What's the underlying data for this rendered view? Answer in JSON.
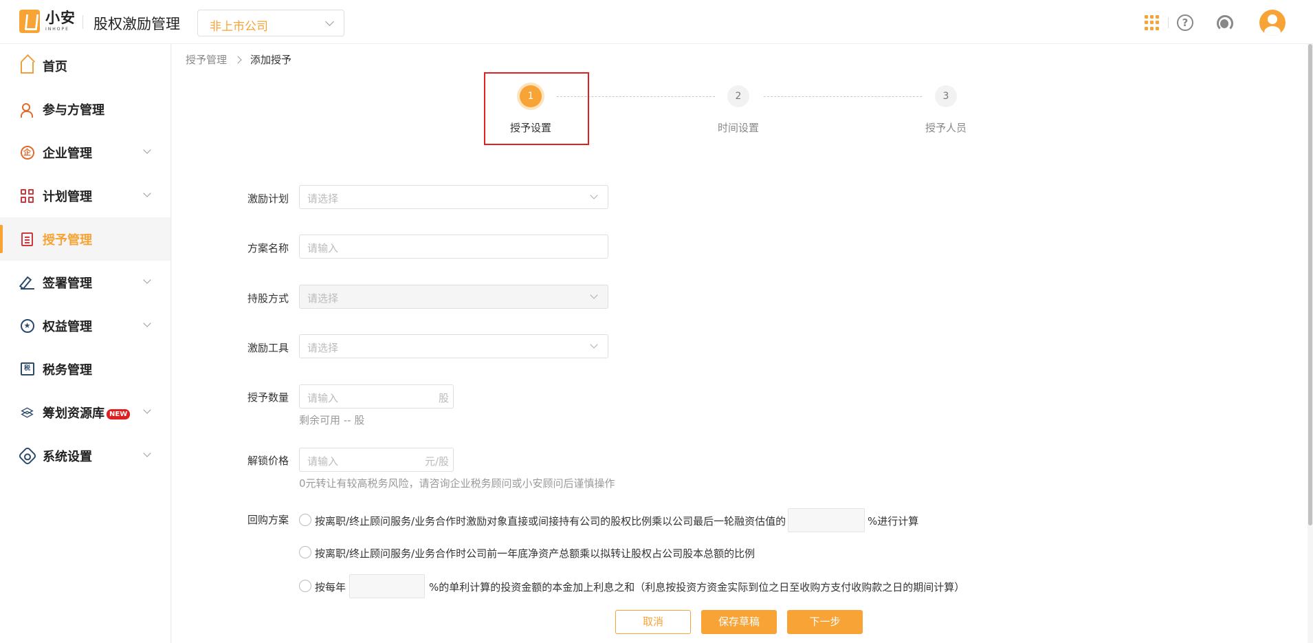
{
  "header": {
    "logo_cn": "小安",
    "logo_en": "INHOPE",
    "app_title": "股权激励管理",
    "company_select": "非上市公司",
    "icons": [
      "apps-grid-icon",
      "help-icon",
      "customer-service-icon",
      "user-avatar-icon"
    ],
    "accent_color": "#f7a335"
  },
  "sidebar": {
    "items": [
      {
        "label": "首页",
        "icon": "home-icon",
        "has_children": false,
        "active": false
      },
      {
        "label": "参与方管理",
        "icon": "participants-icon",
        "has_children": false,
        "active": false
      },
      {
        "label": "企业管理",
        "icon": "enterprise-icon",
        "has_children": true,
        "active": false
      },
      {
        "label": "计划管理",
        "icon": "plan-icon",
        "has_children": true,
        "active": false
      },
      {
        "label": "授予管理",
        "icon": "grant-icon",
        "has_children": false,
        "active": true
      },
      {
        "label": "签署管理",
        "icon": "sign-icon",
        "has_children": true,
        "active": false
      },
      {
        "label": "权益管理",
        "icon": "equity-icon",
        "has_children": true,
        "active": false
      },
      {
        "label": "税务管理",
        "icon": "tax-icon",
        "has_children": false,
        "active": false
      },
      {
        "label": "筹划资源库",
        "icon": "resources-icon",
        "has_children": true,
        "active": false,
        "badge": "NEW"
      },
      {
        "label": "系统设置",
        "icon": "settings-icon",
        "has_children": true,
        "active": false
      }
    ]
  },
  "breadcrumb": {
    "parent": "授予管理",
    "current": "添加授予"
  },
  "steps": [
    {
      "number": "1",
      "label": "授予设置",
      "active": true
    },
    {
      "number": "2",
      "label": "时间设置",
      "active": false
    },
    {
      "number": "3",
      "label": "授予人员",
      "active": false
    }
  ],
  "form": {
    "incentive_plan": {
      "label": "激励计划",
      "placeholder": "请选择"
    },
    "scheme_name": {
      "label": "方案名称",
      "placeholder": "请输入"
    },
    "holding_method": {
      "label": "持股方式",
      "placeholder": "请选择"
    },
    "incentive_tool": {
      "label": "激励工具",
      "placeholder": "请选择"
    },
    "grant_quantity": {
      "label": "授予数量",
      "placeholder": "请输入",
      "suffix": "股",
      "hint": "剩余可用 -- 股"
    },
    "unlock_price": {
      "label": "解锁价格",
      "placeholder": "请输入",
      "suffix": "元/股",
      "hint": "0元转让有较高税务风险，请咨询企业税务顾问或小安顾问后谨慎操作"
    },
    "buyback": {
      "label": "回购方案",
      "option1_pre": "按离职/终止顾问服务/业务合作时激励对象直接或间接持有公司的股权比例乘以公司最后一轮融资估值的",
      "option1_post": "%进行计算",
      "option2": "按离职/终止顾问服务/业务合作时公司前一年底净资产总额乘以拟转让股权占公司股本总额的比例",
      "option3_pre": "按每年",
      "option3_post": "%的单利计算的投资金额的本金加上利息之和（利息按投资方资金实际到位之日至收购方支付收购款之日的期间计算）"
    }
  },
  "actions": {
    "cancel": "取消",
    "save_draft": "保存草稿",
    "next": "下一步"
  }
}
